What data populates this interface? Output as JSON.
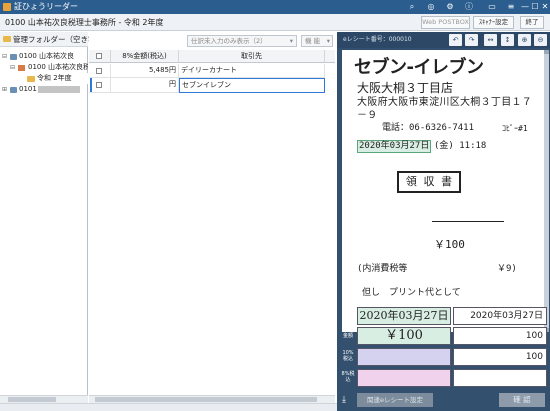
{
  "window": {
    "title": "証ひょうリーダー",
    "icons": [
      "search-icon",
      "globe-icon",
      "settings-icon",
      "info-icon",
      "monitor-icon",
      "menu-icon"
    ],
    "min_glyph": "—",
    "max_glyph": "☐",
    "close_glyph": "✕"
  },
  "subbar": {
    "office": "0100 山本祐次良税理士事務所 - 令和 2年度",
    "web_postbox": "Web POSTBOX",
    "scanner_settings": "ｽｷｬﾅｰ設定",
    "exit": "終了"
  },
  "left": {
    "header": "管理フォルダー（空き容",
    "tree": [
      {
        "label": "0100 山本祐次良",
        "level": 0
      },
      {
        "label": "0100 山本祐次良税",
        "level": 1
      },
      {
        "label": "令和 2年度",
        "level": 2
      },
      {
        "label": "0101",
        "level": 0
      }
    ]
  },
  "middle": {
    "filter": "仕訳未入力のみ表示（2）",
    "function": "機 能",
    "columns": {
      "amount": "8%金額(税込)",
      "partner": "取引先"
    },
    "rows": [
      {
        "amount": "5,485円",
        "partner": "デイリーカナート"
      },
      {
        "amount": "円",
        "partner": "セブンイレブン"
      }
    ]
  },
  "right": {
    "receipt_no_label": "eレシート番号：000010",
    "toolbar_icons": [
      "rotate-left-icon",
      "rotate-right-icon",
      "fit-width-icon",
      "fit-height-icon",
      "zoom-in-icon",
      "zoom-out-icon"
    ],
    "receipt": {
      "brand": "セブン-イレブン",
      "store": "大阪大桐３丁目店",
      "address": "大阪府大阪市東淀川区大桐３丁目１７－９",
      "phone": "電話：06-6326-7411",
      "register": "ｺﾋﾟｰ#1",
      "date": "2020年03月27日",
      "weekday_time": "(金) 11:18",
      "doc_title": "領 収 書",
      "total": "￥100",
      "tax_label": "(内消費税等",
      "tax_value": "￥9)",
      "note": "但し　プリント代として"
    },
    "fields": {
      "date_label": "日付",
      "date_ocr": "2020年03月27日",
      "date_value": "2020年03月27日",
      "total_label": "合計金額",
      "total_ocr": "￥100",
      "total_value": "100",
      "r10_label": "10%税込",
      "r10_value": "100",
      "r8_label": "8%税込",
      "r8_value": ""
    },
    "related_button": "関連eレシート設定",
    "confirm_button": "確 認"
  },
  "colors": {
    "titlebar": "#2b5d8e",
    "right_panel": "#33506f",
    "ocr_green": "#d9eee2",
    "ocr_purple": "#d4d2ee",
    "ocr_pink": "#f0d2ec"
  }
}
